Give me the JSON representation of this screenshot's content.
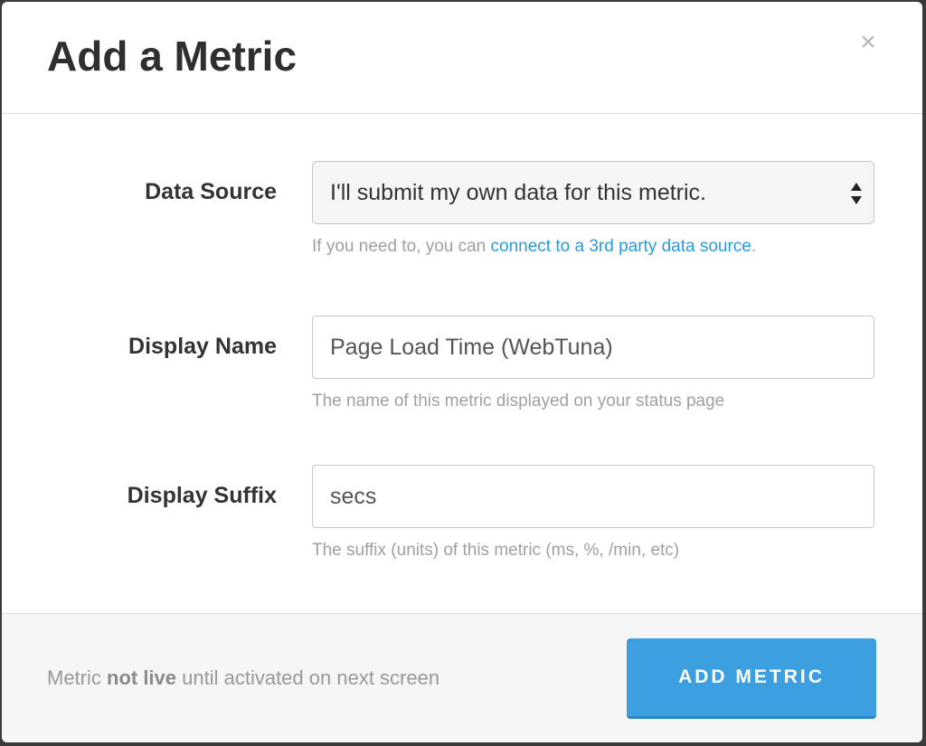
{
  "modal": {
    "title": "Add a Metric",
    "close_symbol": "×"
  },
  "form": {
    "data_source": {
      "label": "Data Source",
      "selected": "I'll submit my own data for this metric.",
      "help_prefix": "If you need to, you can ",
      "help_link": "connect to a 3rd party data source",
      "help_suffix": "."
    },
    "display_name": {
      "label": "Display Name",
      "value": "Page Load Time (WebTuna)",
      "help": "The name of this metric displayed on your status page"
    },
    "display_suffix": {
      "label": "Display Suffix",
      "value": "secs",
      "help": "The suffix (units) of this metric (ms, %, /min, etc)"
    }
  },
  "footer": {
    "note_prefix": "Metric ",
    "note_strong": "not live",
    "note_suffix": " until activated on next screen",
    "button_label": "ADD METRIC"
  },
  "colors": {
    "accent": "#3b9fe0",
    "link": "#2b9adb",
    "title": "#2f2f2f",
    "muted": "#a0a0a0"
  },
  "icons": {
    "close": "close-icon",
    "select_arrows": "select-arrows-icon"
  }
}
